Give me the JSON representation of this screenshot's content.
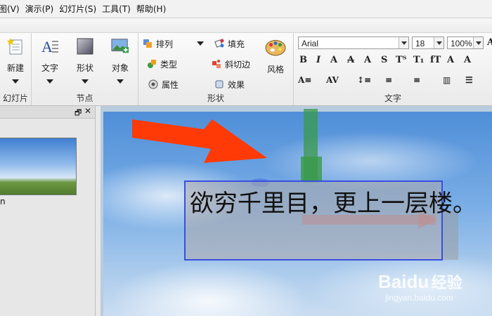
{
  "menubar": {
    "items": [
      "图(V)",
      "演示(P)",
      "幻灯片(S)",
      "工具(T)",
      "帮助(H)"
    ]
  },
  "ribbon": {
    "slides_group": {
      "label": "幻灯片",
      "new_label": "新建"
    },
    "sections_group": {
      "label": "节点",
      "text_label": "文字",
      "shape_label": "形状",
      "object_label": "对象"
    },
    "shape_group": {
      "label": "形状",
      "arrange_label": "排列",
      "type_label": "类型",
      "property_label": "属性",
      "fill_label": "填充",
      "bevel_label": "斜切边",
      "effect_label": "效果",
      "style_label": "风格"
    },
    "text_group": {
      "label": "文字",
      "font_family": "Arial",
      "font_size": "18",
      "zoom": "100%"
    }
  },
  "panel": {
    "thumb_caption": "n"
  },
  "slide": {
    "text": "欲穷千里目，更上一层楼。"
  },
  "watermark": {
    "brand": "Baidu",
    "brand_cn": "经验",
    "url": "jingyan.baidu.com"
  },
  "colors": {
    "accent": "#3a4fe0",
    "arrow": "#ff3a06",
    "green": "#3a9a4a"
  }
}
